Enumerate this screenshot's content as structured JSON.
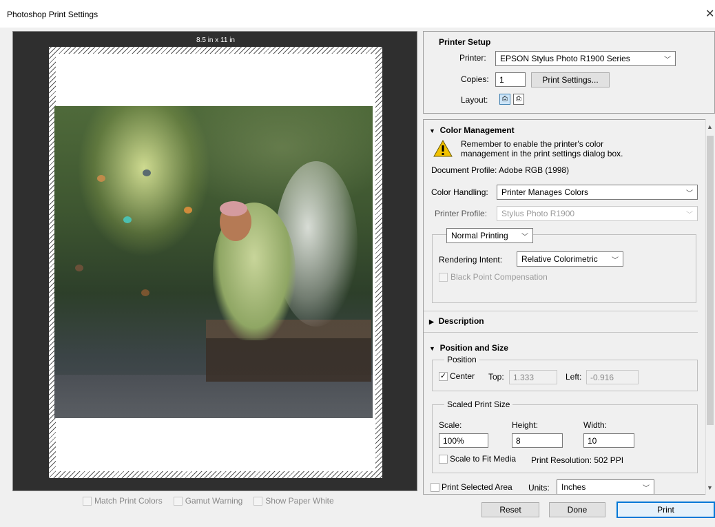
{
  "window": {
    "title": "Photoshop Print Settings",
    "close_glyph": "✕"
  },
  "preview": {
    "paper_size": "8.5 in x 11 in",
    "options": [
      "Match Print Colors",
      "Gamut Warning",
      "Show Paper White"
    ]
  },
  "printer_setup": {
    "heading": "Printer Setup",
    "printer_label": "Printer:",
    "printer_value": "EPSON Stylus Photo R1900 Series",
    "copies_label": "Copies:",
    "copies_value": "1",
    "print_settings_button": "Print Settings...",
    "layout_label": "Layout:"
  },
  "color_management": {
    "heading": "Color Management",
    "warning_line1": "Remember to enable the printer's color",
    "warning_line2": "management in the print settings dialog box.",
    "document_profile": "Document Profile: Adobe RGB (1998)",
    "color_handling_label": "Color Handling:",
    "color_handling_value": "Printer Manages Colors",
    "printer_profile_label": "Printer Profile:",
    "printer_profile_value": "Stylus Photo R1900",
    "printing_mode": "Normal Printing",
    "rendering_intent_label": "Rendering Intent:",
    "rendering_intent_value": "Relative Colorimetric",
    "black_point": "Black Point Compensation"
  },
  "description": {
    "heading": "Description"
  },
  "position_size": {
    "heading": "Position and Size",
    "position_legend": "Position",
    "center_label": "Center",
    "top_label": "Top:",
    "top_value": "1.333",
    "left_label": "Left:",
    "left_value": "-0.916",
    "scaled_legend": "Scaled Print Size",
    "scale_label": "Scale:",
    "scale_value": "100%",
    "height_label": "Height:",
    "height_value": "8",
    "width_label": "Width:",
    "width_value": "10",
    "fit_media_label": "Scale to Fit Media",
    "resolution": "Print Resolution: 502 PPI",
    "selected_area_label": "Print Selected Area",
    "units_label": "Units:",
    "units_value": "Inches"
  },
  "footer": {
    "reset": "Reset",
    "done": "Done",
    "print": "Print"
  },
  "icons": {
    "warning": "warning-icon",
    "expand": "triangle-down",
    "collapse": "triangle-right"
  },
  "colors": {
    "accent": "#0078d7",
    "warning": "#f2c200"
  }
}
